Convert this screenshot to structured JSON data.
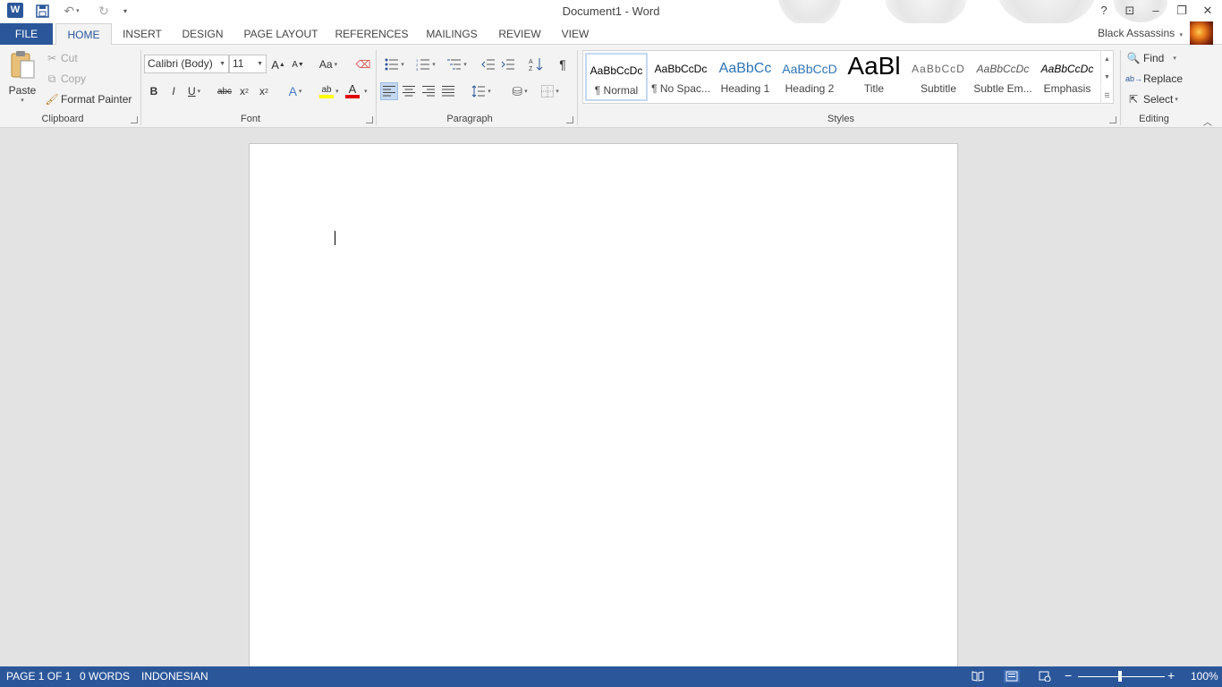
{
  "window": {
    "title": "Document1 - Word",
    "app_icon": "word-icon",
    "app_icon_letter": "W",
    "controls": {
      "help": "?",
      "ribbon_display": "⊡",
      "minimize": "–",
      "restore": "❐",
      "close": "✕"
    }
  },
  "quick_access": [
    {
      "name": "save-icon",
      "glyph": "💾"
    },
    {
      "name": "undo-icon",
      "glyph": "↶"
    },
    {
      "name": "redo-icon",
      "glyph": "↻"
    },
    {
      "name": "customize-qat-icon",
      "glyph": "▾"
    }
  ],
  "tabs": {
    "file": "FILE",
    "items": [
      {
        "label": "HOME",
        "active": true
      },
      {
        "label": "INSERT",
        "active": false
      },
      {
        "label": "DESIGN",
        "active": false
      },
      {
        "label": "PAGE LAYOUT",
        "active": false
      },
      {
        "label": "REFERENCES",
        "active": false
      },
      {
        "label": "MAILINGS",
        "active": false
      },
      {
        "label": "REVIEW",
        "active": false
      },
      {
        "label": "VIEW",
        "active": false
      }
    ],
    "user_name": "Black Assassins"
  },
  "ribbon": {
    "clipboard": {
      "label": "Clipboard",
      "paste": "Paste",
      "cut": "Cut",
      "copy": "Copy",
      "format_painter": "Format Painter"
    },
    "font": {
      "label": "Font",
      "font_name": "Calibri (Body)",
      "font_size": "11",
      "grow": "A",
      "shrink": "A",
      "change_case": "Aa",
      "bold": "B",
      "italic": "I",
      "underline": "U",
      "strikethrough": "abc",
      "subscript": "x",
      "superscript": "x",
      "text_effects": "A",
      "highlight": "ab",
      "font_color": "A",
      "highlight_color": "#ffff00",
      "font_color_value": "#e00000"
    },
    "paragraph": {
      "label": "Paragraph",
      "show_marks": "¶",
      "alignment": "left"
    },
    "styles": {
      "label": "Styles",
      "items": [
        {
          "sample": "AaBbCcDc",
          "name": "¶ Normal",
          "selected": true
        },
        {
          "sample": "AaBbCcDc",
          "name": "¶ No Spac...",
          "selected": false
        },
        {
          "sample": "AaBbCc",
          "name": "Heading 1",
          "selected": false
        },
        {
          "sample": "AaBbCcD",
          "name": "Heading 2",
          "selected": false
        },
        {
          "sample": "AaBl",
          "name": "Title",
          "selected": false
        },
        {
          "sample": "AaBbCcD",
          "name": "Subtitle",
          "selected": false
        },
        {
          "sample": "AaBbCcDc",
          "name": "Subtle Em...",
          "selected": false
        },
        {
          "sample": "AaBbCcDc",
          "name": "Emphasis",
          "selected": false
        }
      ]
    },
    "editing": {
      "label": "Editing",
      "find": "Find",
      "replace": "Replace",
      "select": "Select"
    }
  },
  "status": {
    "page": "PAGE 1 OF 1",
    "words": "0 WORDS",
    "language": "INDONESIAN",
    "zoom": "100%",
    "zoom_minus": "−",
    "zoom_plus": "+",
    "view": "print-layout"
  },
  "colors": {
    "accent": "#2b579a",
    "ribbon_bg": "#f3f3f3",
    "workspace_bg": "#e3e3e3"
  }
}
